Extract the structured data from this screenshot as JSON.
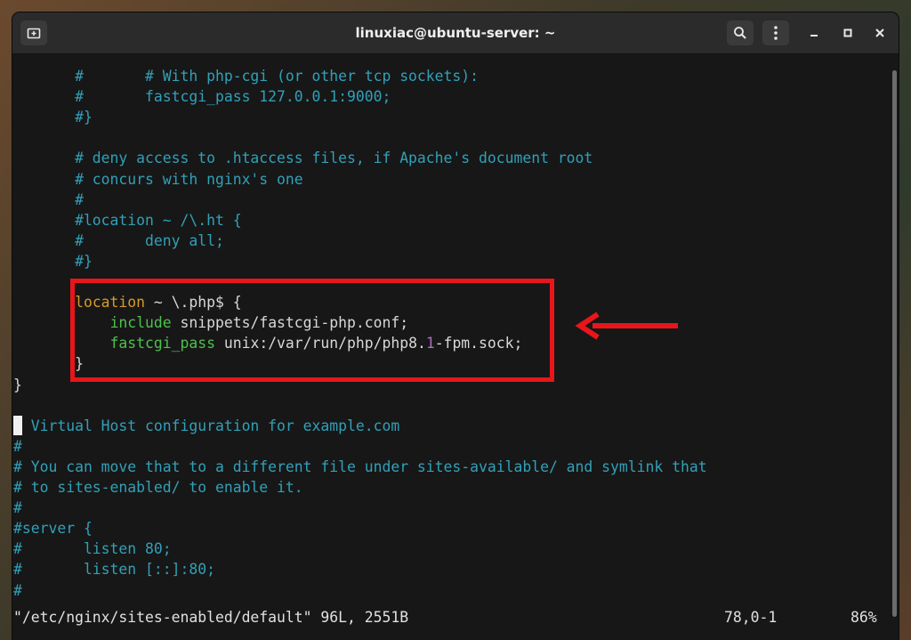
{
  "window": {
    "title": "linuxiac@ubuntu-server: ~",
    "buttons": {
      "new_tab_icon": "new-tab-icon",
      "search_icon": "search-icon",
      "menu_icon": "kebab-menu-icon",
      "minimize_icon": "minimize-icon",
      "maximize_icon": "maximize-icon",
      "close_icon": "close-icon"
    }
  },
  "editor": {
    "lines": [
      [
        {
          "t": "       #       # With php-cgi (or other tcp sockets):",
          "c": "c-comment"
        }
      ],
      [
        {
          "t": "       #       fastcgi_pass 127.0.0.1:9000;",
          "c": "c-comment"
        }
      ],
      [
        {
          "t": "       #}",
          "c": "c-comment"
        }
      ],
      [
        {
          "t": "",
          "c": "c-plain"
        }
      ],
      [
        {
          "t": "       # deny access to .htaccess files, if Apache's document root",
          "c": "c-comment"
        }
      ],
      [
        {
          "t": "       # concurs with nginx's one",
          "c": "c-comment"
        }
      ],
      [
        {
          "t": "       #",
          "c": "c-comment"
        }
      ],
      [
        {
          "t": "       #location ~ /\\.ht {",
          "c": "c-comment"
        }
      ],
      [
        {
          "t": "       #       deny all;",
          "c": "c-comment"
        }
      ],
      [
        {
          "t": "       #}",
          "c": "c-comment"
        }
      ],
      [
        {
          "t": "",
          "c": "c-plain"
        }
      ],
      [
        {
          "t": "       ",
          "c": "c-plain"
        },
        {
          "t": "location",
          "c": "c-kw"
        },
        {
          "t": " ~ \\.php$ {",
          "c": "c-plain"
        }
      ],
      [
        {
          "t": "           ",
          "c": "c-plain"
        },
        {
          "t": "include",
          "c": "c-green"
        },
        {
          "t": " snippets/fastcgi-php.conf;",
          "c": "c-plain"
        }
      ],
      [
        {
          "t": "           ",
          "c": "c-plain"
        },
        {
          "t": "fastcgi_pass",
          "c": "c-green"
        },
        {
          "t": " unix:/var/run/php/php8.",
          "c": "c-plain"
        },
        {
          "t": "1",
          "c": "c-num"
        },
        {
          "t": "-fpm.sock;",
          "c": "c-plain"
        }
      ],
      [
        {
          "t": "       }",
          "c": "c-plain"
        }
      ],
      [
        {
          "t": "}",
          "c": "c-plain"
        }
      ],
      [
        {
          "t": "",
          "c": "c-plain"
        }
      ],
      [
        {
          "t": "# Virtual Host configuration for example.com",
          "c": "c-comment"
        }
      ],
      [
        {
          "t": "#",
          "c": "c-comment"
        }
      ],
      [
        {
          "t": "# You can move that to a different file under sites-available/ and symlink that",
          "c": "c-comment"
        }
      ],
      [
        {
          "t": "# to sites-enabled/ to enable it.",
          "c": "c-comment"
        }
      ],
      [
        {
          "t": "#",
          "c": "c-comment"
        }
      ],
      [
        {
          "t": "#server {",
          "c": "c-comment"
        }
      ],
      [
        {
          "t": "#       listen 80;",
          "c": "c-comment"
        }
      ],
      [
        {
          "t": "#       listen [::]:80;",
          "c": "c-comment"
        }
      ],
      [
        {
          "t": "#",
          "c": "c-comment"
        }
      ]
    ],
    "status": {
      "file": "\"/etc/nginx/sites-enabled/default\" 96L, 2551B",
      "position": "78,0-1",
      "percent": "86%"
    }
  },
  "annotation": {
    "box_color": "#e8161a",
    "arrow_color": "#e8161a"
  }
}
